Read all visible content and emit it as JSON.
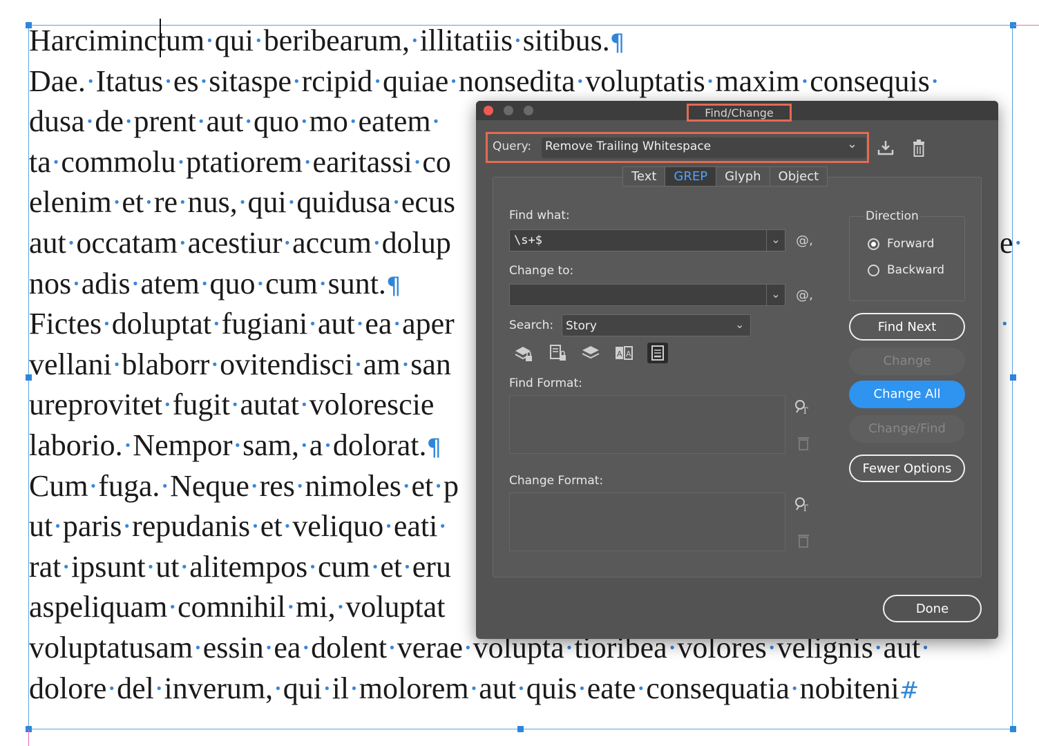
{
  "document": {
    "lines": [
      {
        "words": [
          "Harciminctum",
          "qui",
          "beribearum,",
          "illitatiis",
          "sitibus."
        ],
        "end": "¶"
      },
      {
        "words": [
          "Dae.",
          "Itatus",
          "es",
          "sitaspe",
          "rcipid",
          "quiae",
          "nonsedita",
          "voluptatis",
          "maxim",
          "consequis"
        ],
        "end": "·"
      },
      {
        "words": [
          "dusa",
          "de",
          "prent",
          "aut",
          "quo",
          "mo",
          "eatem"
        ],
        "end": "·"
      },
      {
        "words": [
          "ta",
          "commolu",
          "ptatiorem",
          "earitassi",
          "co"
        ],
        "end": ""
      },
      {
        "words": [
          "elenim",
          "et",
          "re",
          "nus,",
          "qui",
          "quidusa",
          "ecus"
        ],
        "end": ""
      },
      {
        "words": [
          "aut",
          "occatam",
          "acestiur",
          "accum",
          "dolup"
        ],
        "end": ""
      },
      {
        "words": [
          "nos",
          "adis",
          "atem",
          "quo",
          "cum",
          "sunt."
        ],
        "end": "¶"
      },
      {
        "words": [
          "Fictes",
          "doluptat",
          "fugiani",
          "aut",
          "ea",
          "aper"
        ],
        "end": ""
      },
      {
        "words": [
          "vellani",
          "blaborr",
          "ovitendisci",
          "am",
          "san"
        ],
        "end": ""
      },
      {
        "words": [
          "ureprovitet",
          "fugit",
          "autat",
          "volorescie"
        ],
        "end": ""
      },
      {
        "words": [
          "laborio.",
          "Nempor",
          "sam,",
          "a",
          "dolorat."
        ],
        "end": "¶"
      },
      {
        "words": [
          "Cum",
          "fuga.",
          "Neque",
          "res",
          "nimoles",
          "et",
          "p"
        ],
        "end": ""
      },
      {
        "words": [
          "ut",
          "paris",
          "repudanis",
          "et",
          "veliquo",
          "eati"
        ],
        "end": "·"
      },
      {
        "words": [
          "rat",
          "ipsunt",
          "ut",
          "alitempos",
          "cum",
          "et",
          "eru"
        ],
        "end": ""
      },
      {
        "words": [
          "aspeliquam",
          "comnihil",
          "mi,",
          "voluptat"
        ],
        "end": ""
      },
      {
        "words": [
          "voluptatusam",
          "essin",
          "ea",
          "dolent",
          "verae",
          "volupta",
          "tioribea",
          "volores",
          "velignis",
          "aut"
        ],
        "end": "·"
      },
      {
        "words": [
          "dolore",
          "del",
          "inverum,",
          "qui",
          "il",
          "molorem",
          "aut",
          "quis",
          "eate",
          "consequatia",
          "nobiteni"
        ],
        "end": "#"
      }
    ],
    "behind_right": [
      {
        "text": "e·",
        "line": 5
      },
      {
        "text": "·",
        "line": 7
      }
    ]
  },
  "dialog": {
    "title": "Find/Change",
    "query_label": "Query:",
    "query_value": "Remove Trailing Whitespace",
    "tabs": [
      {
        "label": "Text",
        "active": false
      },
      {
        "label": "GREP",
        "active": true
      },
      {
        "label": "Glyph",
        "active": false
      },
      {
        "label": "Object",
        "active": false
      }
    ],
    "find_what_label": "Find what:",
    "find_what_value": "\\s+$",
    "change_to_label": "Change to:",
    "change_to_value": "",
    "special_char_icon": "@,",
    "search_label": "Search:",
    "search_value": "Story",
    "find_format_label": "Find Format:",
    "change_format_label": "Change Format:",
    "direction_label": "Direction",
    "direction_options": [
      {
        "label": "Forward",
        "selected": true
      },
      {
        "label": "Backward",
        "selected": false
      }
    ],
    "buttons": {
      "find_next": "Find Next",
      "change": "Change",
      "change_all": "Change All",
      "change_find": "Change/Find",
      "fewer_options": "Fewer Options",
      "done": "Done"
    },
    "accent": "#2f93f0",
    "highlight": "#e56a52"
  }
}
